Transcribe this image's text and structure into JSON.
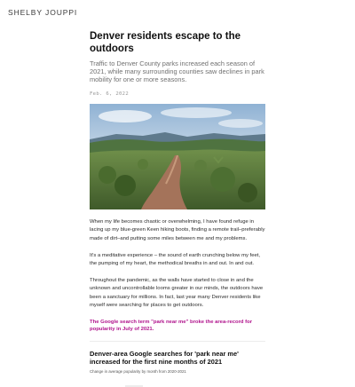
{
  "site": {
    "name": "SHELBY JOUPPI"
  },
  "article": {
    "title": "Denver residents escape to the outdoors",
    "subtitle": "Traffic to Denver County parks increased each season of 2021, while many surrounding counties saw declines in park mobility for one or more seasons.",
    "date": "Feb. 6, 2022",
    "hero_image": {
      "icon": "landscape-photo",
      "description_colors": {
        "sky": "#b9cde0",
        "hills": "#5b7a3f",
        "trail": "#a4735a"
      }
    },
    "paragraphs": [
      "When my life becomes chaotic or overwhelming, I have found refuge in lacing up my blue-green Keen hiking boots, finding a remote trail–preferably made of dirt–and putting some miles between me and my problems.",
      "It's a meditative experience – the sound of earth crunching below my feet, the pumping of my heart, the methodical breaths in and out. In and out.",
      "Throughout the pandemic, as the walls have started to close in and the unknown and uncontrollable looms greater in our minds, the outdoors have been a sanctuary for millions. In fact, last year many Denver residents like myself were searching for places to get outdoors."
    ],
    "pull_quote": "The Google search term \"park near me\" broke the area-record for popularity in July of 2021.",
    "figure": {
      "title": "Denver-area Google searches for 'park near me' increased for the first nine months of 2021",
      "caption": "Change in average popularity by month from 2020-2021"
    }
  },
  "colors": {
    "accent": "#b0138c",
    "text": "#1f1f1f",
    "muted": "#707070"
  }
}
